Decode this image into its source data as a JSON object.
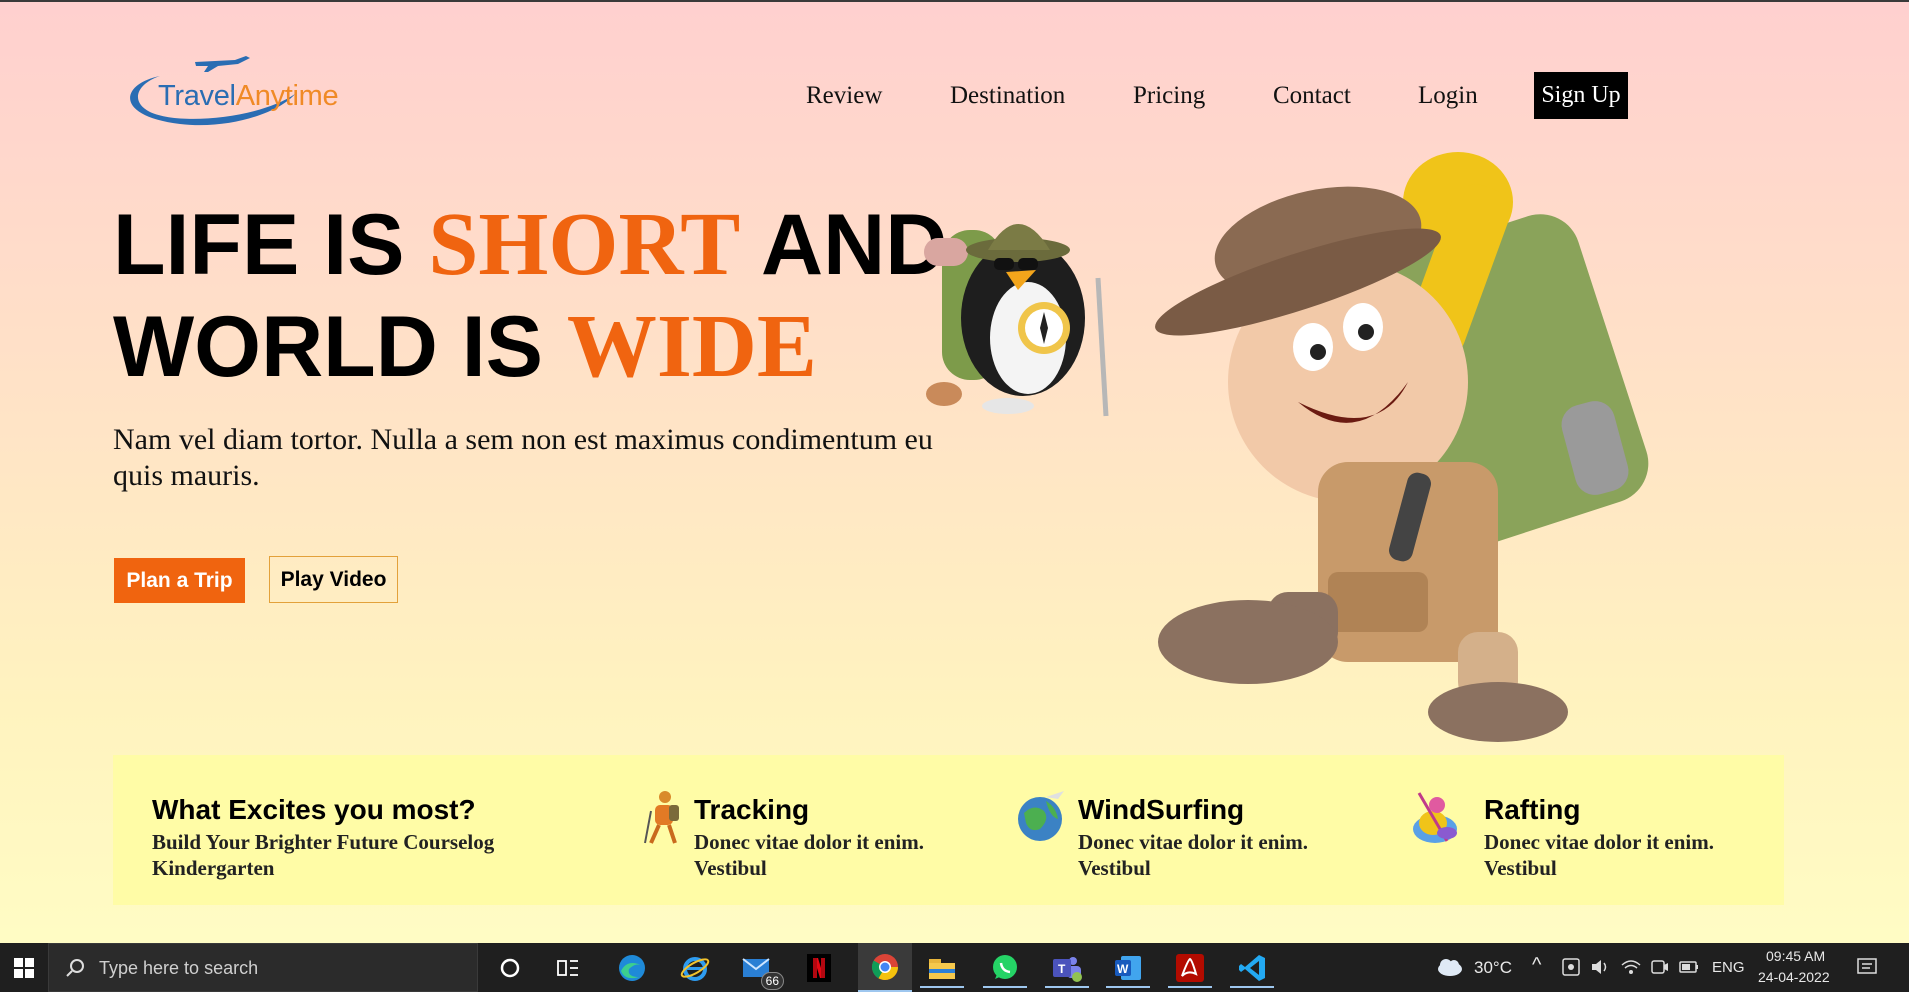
{
  "logo": {
    "part1": "Travel",
    "part2": "Anytime"
  },
  "nav": {
    "items": [
      "Review",
      "Destination",
      "Pricing",
      "Contact",
      "Login"
    ],
    "signup_label": "Sign Up"
  },
  "hero": {
    "line1_a": "LIFE IS ",
    "line1_accent": "SHORT",
    "line1_b": " AND",
    "line2_a": "WORLD IS ",
    "line2_accent": "WIDE",
    "subtitle": "Nam vel diam tortor. Nulla a sem non est maximus condimentum eu quis mauris.",
    "primary_button": "Plan a Trip",
    "secondary_button": "Play Video"
  },
  "features": {
    "intro_title": "What Excites you most?",
    "intro_text": "Build Your Brighter Future Courselog Kindergarten",
    "items": [
      {
        "title": "Tracking",
        "text": "Donec vitae dolor it enim. Vestibul",
        "icon": "hiker-icon"
      },
      {
        "title": "WindSurfing",
        "text": "Donec vitae dolor it enim. Vestibul",
        "icon": "globe-plane-icon"
      },
      {
        "title": "Rafting",
        "text": "Donec vitae dolor it enim. Vestibul",
        "icon": "rafting-icon"
      }
    ]
  },
  "taskbar": {
    "search_placeholder": "Type here to search",
    "mail_badge": "66",
    "weather": "30°C",
    "language": "ENG",
    "time": "09:45 AM",
    "date": "24-04-2022",
    "apps": [
      "task-view-icon",
      "edge-icon",
      "internet-explorer-icon",
      "mail-icon",
      "netflix-icon",
      "chrome-icon",
      "file-explorer-icon",
      "whatsapp-icon",
      "teams-icon",
      "word-icon",
      "acrobat-icon",
      "vscode-icon"
    ]
  },
  "colors": {
    "accent": "#f0640f",
    "background_top": "#ffd0cf",
    "background_bottom": "#fffcc4",
    "feature_band": "#fffca6"
  }
}
